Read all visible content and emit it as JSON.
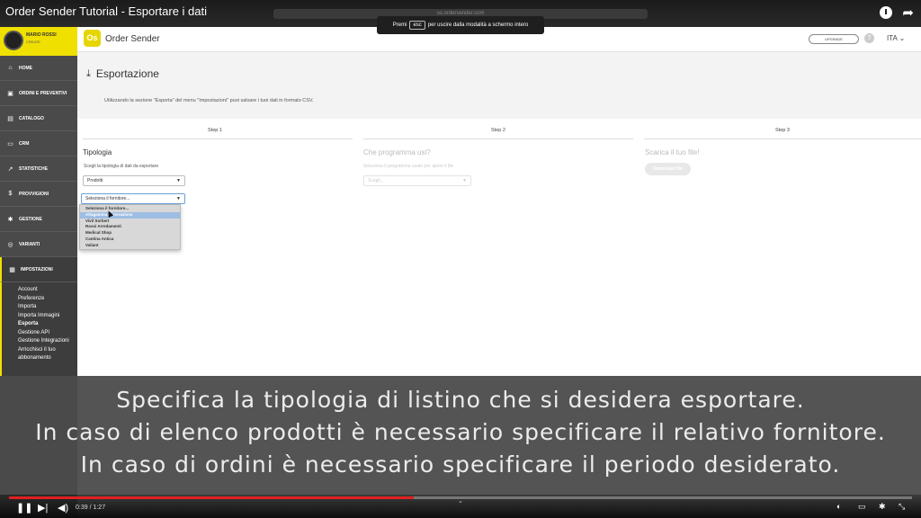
{
  "video": {
    "title": "Order Sender Tutorial - Esportare i dati",
    "url_bar": "os.ordersender.com",
    "current_time": "0:39",
    "duration": "1:27",
    "progress": 0.448
  },
  "fullscreen_toast": {
    "prefix": "Premi",
    "key": "esc",
    "suffix": "per uscire dalla modalità a schermo intero"
  },
  "user": {
    "name": "MARIO ROSSI",
    "role": "CREATE"
  },
  "sidebar": {
    "items": [
      {
        "label": "HOME",
        "icon": "home-icon",
        "glyph": "⌂"
      },
      {
        "label": "ORDINI E PREVENTIVI",
        "icon": "cart-icon",
        "glyph": "▣"
      },
      {
        "label": "CATALOGO",
        "icon": "catalog-icon",
        "glyph": "▤"
      },
      {
        "label": "CRM",
        "icon": "crm-icon",
        "glyph": "▭"
      },
      {
        "label": "STATISTICHE",
        "icon": "chart-icon",
        "glyph": "↗"
      },
      {
        "label": "PROVVIGIONI",
        "icon": "dollar-icon",
        "glyph": "$"
      },
      {
        "label": "GESTIONE",
        "icon": "gear-icon",
        "glyph": "✱"
      },
      {
        "label": "VARIANTI",
        "icon": "variants-icon",
        "glyph": "◎"
      },
      {
        "label": "IMPOSTAZIONI",
        "icon": "settings-icon",
        "glyph": "▦"
      }
    ],
    "sub_items": [
      "Account",
      "Preferenze",
      "Importa",
      "Importa Immagini",
      "Esporta",
      "Gestione API",
      "Gestione Integrazioni",
      "Arricchisci il tuo",
      "abbonamento"
    ],
    "current_sub": "Esporta"
  },
  "header": {
    "logo_mark": "Os",
    "logo_text": "Order Sender",
    "upgrade": "UPGRADE",
    "help": "?",
    "language": "ITA"
  },
  "page": {
    "title": "Esportazione",
    "intro": "Utilizzando la sezione \"Esporta\" del menu \"Impostazioni\" puoi salvare i tuoi dati in formato CSV."
  },
  "steps": [
    {
      "head": "Step 1",
      "title": "Tipologia",
      "desc": "Scegli la tipologia di dati da esportare",
      "select": "Prodotti"
    },
    {
      "head": "Step 2",
      "title": "Che programma usi?",
      "desc": "Seleziona il programma usato per aprire il file",
      "select": "Scegli..."
    },
    {
      "head": "Step 3",
      "title": "Scarica il tuo file!",
      "button": "Download file"
    }
  ],
  "supplier_select": {
    "value": "Seleziona il fornitore..."
  },
  "dropdown_options": [
    "Seleziona il fornitore...",
    "Altagamma Ristorazione",
    "Vivil Sorbert",
    "Rossi Arredamenti",
    "Medical Shop",
    "Cantina Antica",
    "Valiant"
  ],
  "subtitles": [
    "Specifica la tipologia di listino che si desidera esportare.",
    "In caso di elenco prodotti è necessario specificare il relativo fornitore.",
    "In caso di ordini è necessario specificare il periodo desiderato."
  ]
}
